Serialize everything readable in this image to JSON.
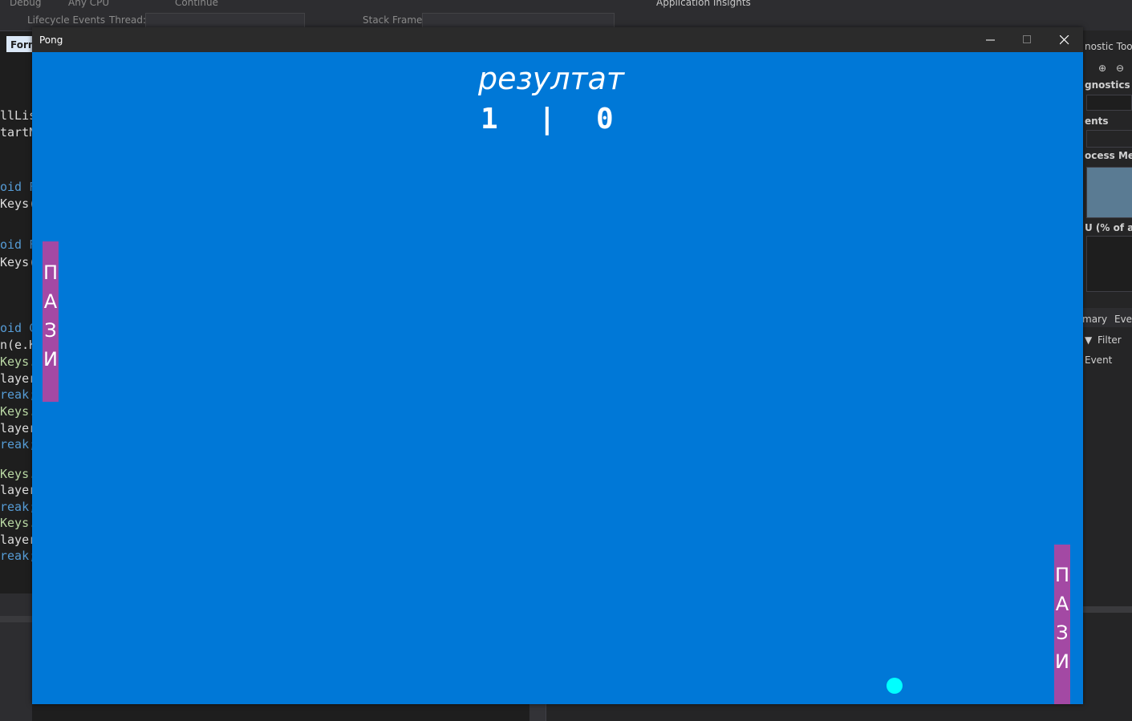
{
  "ide": {
    "toolbar_debug": "Debug",
    "toolbar_cpu": "Any CPU",
    "toolbar_continue": "Continue",
    "toolbar_insights": "Application Insights",
    "lifecycle": "Lifecycle Events",
    "thread_label": "Thread:",
    "stack_frame_label": "Stack Frame:",
    "editor_tab": "Form",
    "code_lines": [
      "llLis",
      "tartN",
      "oid F",
      "Keys(",
      "oid F",
      "Keys(",
      "oid C",
      "n(e.K",
      "Keys.",
      "layer",
      "reak;",
      "Keys.",
      "layer",
      "reak;",
      "Keys.",
      "layer",
      "reak;",
      "Keys.",
      "layer",
      "reak;"
    ],
    "diag_title": "nostic Tools",
    "diag_sessions": "gnostics ses",
    "diag_events": "ents",
    "diag_memory": "ocess Memo",
    "diag_cpu": "U (% of all p",
    "diag_tab_summary": "mary",
    "diag_tab_events": "Eve",
    "diag_filter": "Filter",
    "diag_event_col": "Event"
  },
  "window": {
    "title": "Pong"
  },
  "game": {
    "score_label": "резултат",
    "score_left": "1",
    "score_sep": "|",
    "score_right": "0",
    "paddle_left_letters": [
      "П",
      "А",
      "З",
      "И"
    ],
    "paddle_right_letters": [
      "П",
      "А",
      "З",
      "И"
    ],
    "colors": {
      "background": "#0078d7",
      "paddle": "#a349a4",
      "ball": "#00ffff"
    }
  }
}
